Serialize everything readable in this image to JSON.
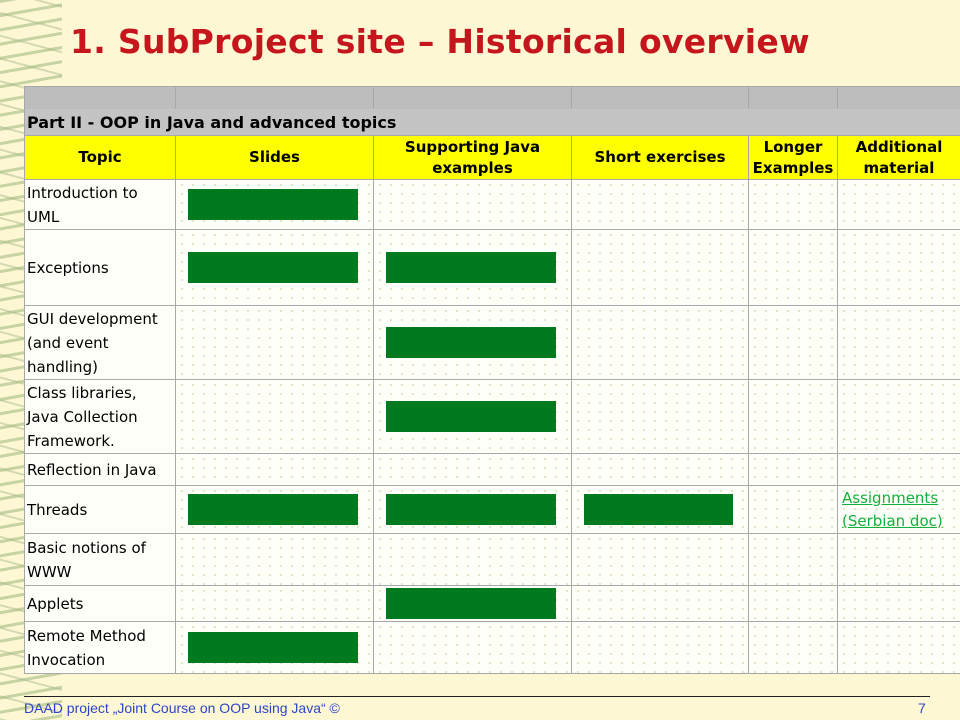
{
  "slide": {
    "title": "1. SubProject site – Historical overview",
    "footer": "DAAD project „Joint Course on OOP using Java“ ©",
    "page_number": "7"
  },
  "table": {
    "part_title": "Part II - OOP in Java and advanced topics",
    "headers": [
      {
        "text": "Topic"
      },
      {
        "text": "Slides"
      },
      {
        "text": "Supporting Java\nexamples"
      },
      {
        "text": "Short exercises"
      },
      {
        "text": "Longer\nExamples"
      },
      {
        "text": "Additional\nmaterial"
      }
    ],
    "rows": [
      {
        "topic": "Introduction to\nUML",
        "slides": true,
        "examples": false,
        "exercises": false,
        "longer": false,
        "additional": ""
      },
      {
        "topic": "Exceptions",
        "slides": true,
        "examples": true,
        "exercises": false,
        "longer": false,
        "additional": ""
      },
      {
        "topic": "GUI development\n(and event\nhandling)",
        "slides": false,
        "examples": true,
        "exercises": false,
        "longer": false,
        "additional": ""
      },
      {
        "topic": "Class libraries,\nJava Collection\nFramework.",
        "slides": false,
        "examples": true,
        "exercises": false,
        "longer": false,
        "additional": ""
      },
      {
        "topic": "Reflection in Java",
        "slides": false,
        "examples": false,
        "exercises": false,
        "longer": false,
        "additional": ""
      },
      {
        "topic": "Threads",
        "slides": true,
        "examples": true,
        "exercises": true,
        "longer": false,
        "additional": "Assignments\n(Serbian doc)"
      },
      {
        "topic": "Basic notions of\nWWW",
        "slides": false,
        "examples": false,
        "exercises": false,
        "longer": false,
        "additional": ""
      },
      {
        "topic": "Applets",
        "slides": false,
        "examples": true,
        "exercises": false,
        "longer": false,
        "additional": ""
      },
      {
        "topic": "Remote Method\nInvocation",
        "slides": true,
        "examples": false,
        "exercises": false,
        "longer": false,
        "additional": ""
      }
    ]
  },
  "colors": {
    "title": "#c4161c",
    "header_bg": "#ffff00",
    "bar": "#007a1f",
    "link": "#11b03a",
    "footer": "#2d45c8"
  }
}
